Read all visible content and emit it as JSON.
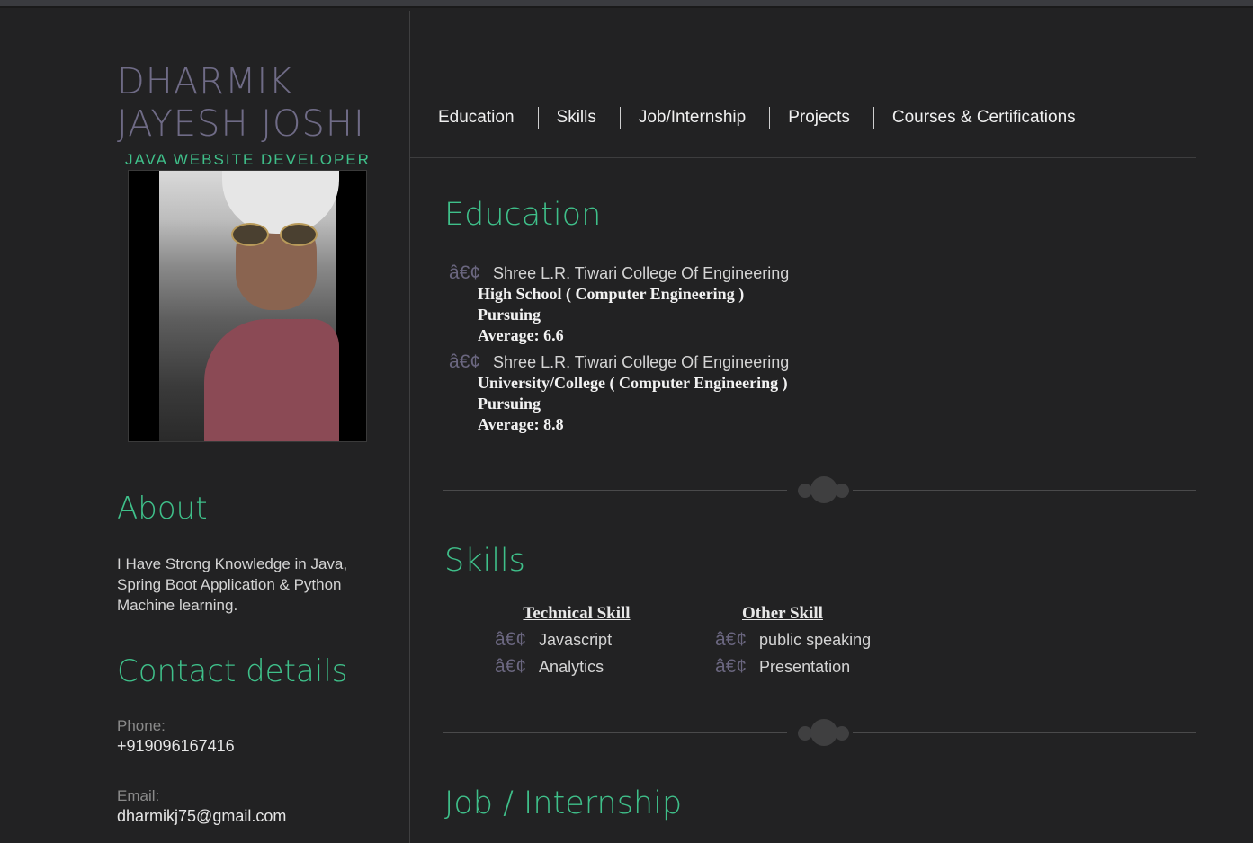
{
  "profile": {
    "name_line1": "DHARMIK",
    "name_line2": "JAYESH JOSHI",
    "role": "JAVA WEBSITE DEVELOPER"
  },
  "sidebar": {
    "about_heading": "About",
    "about_text": "I Have Strong Knowledge in Java, Spring Boot Application & Python Machine learning.",
    "contact_heading": "Contact details",
    "phone_label": "Phone:",
    "phone_value": "+919096167416",
    "email_label": "Email:",
    "email_value": "dharmikj75@gmail.com"
  },
  "nav": {
    "items": [
      "Education",
      "Skills",
      "Job/Internship",
      "Projects",
      "Courses & Certifications"
    ]
  },
  "education": {
    "heading": "Education",
    "bullet": "â€¢",
    "entries": [
      {
        "institution": "Shree L.R. Tiwari College Of Engineering",
        "degree": "High School ( Computer Engineering )",
        "status": "Pursuing",
        "average": "Average: 6.6"
      },
      {
        "institution": "Shree L.R. Tiwari College Of Engineering",
        "degree": "University/College ( Computer Engineering )",
        "status": "Pursuing",
        "average": "Average: 8.8"
      }
    ]
  },
  "skills": {
    "heading": "Skills",
    "technical_heading": "Technical Skill",
    "other_heading": "Other Skill",
    "technical": [
      "Javascript",
      "Analytics"
    ],
    "other": [
      "public speaking",
      "Presentation"
    ]
  },
  "job": {
    "heading": "Job / Internship"
  }
}
